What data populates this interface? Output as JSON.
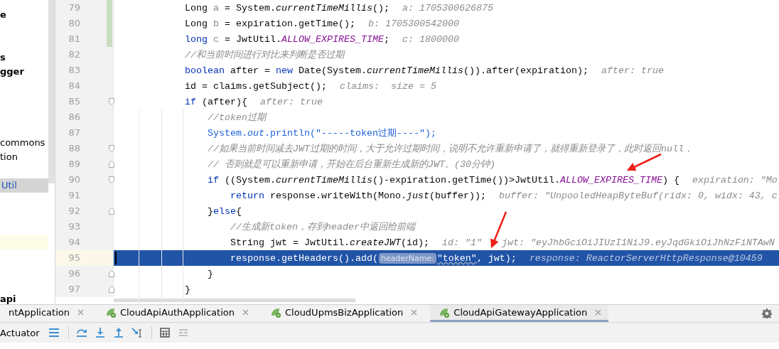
{
  "project_tree": {
    "items": [
      {
        "label": "e",
        "kind": "module",
        "selected": false
      },
      {
        "label": "s",
        "kind": "module",
        "selected": false
      },
      {
        "label": "gger",
        "kind": "module",
        "selected": false
      },
      {
        "label": "commons",
        "kind": "file",
        "selected": false
      },
      {
        "label": "tion",
        "kind": "file",
        "selected": false
      },
      {
        "label": "Util",
        "kind": "file",
        "selected": true
      },
      {
        "label": "api",
        "kind": "module",
        "selected": false
      }
    ]
  },
  "editor": {
    "lines": [
      {
        "number": "79",
        "selected": false,
        "changed": true,
        "fold_start": false,
        "fold_end": false,
        "segments": [
          {
            "kind": "text",
            "text": "Long "
          },
          {
            "kind": "dim",
            "text": "a"
          },
          {
            "kind": "text",
            "text": " = System."
          },
          {
            "kind": "italic",
            "text": "currentTimeMillis"
          },
          {
            "kind": "text",
            "text": "();"
          },
          {
            "kind": "hint",
            "text": "a: 1705300626875"
          }
        ]
      },
      {
        "number": "80",
        "selected": false,
        "changed": true,
        "fold_start": false,
        "fold_end": false,
        "segments": [
          {
            "kind": "text",
            "text": "Long "
          },
          {
            "kind": "dim",
            "text": "b"
          },
          {
            "kind": "text",
            "text": " = expiration.getTime();"
          },
          {
            "kind": "hint",
            "text": "b: 1705300542000"
          }
        ]
      },
      {
        "number": "81",
        "selected": false,
        "changed": true,
        "fold_start": false,
        "fold_end": false,
        "segments": [
          {
            "kind": "keyword",
            "text": "long "
          },
          {
            "kind": "dim",
            "text": "c"
          },
          {
            "kind": "text",
            "text": " = JwtUtil."
          },
          {
            "kind": "constant",
            "text": "ALLOW_EXPIRES_TIME"
          },
          {
            "kind": "text",
            "text": ";"
          },
          {
            "kind": "hint",
            "text": "c: 1800000"
          }
        ]
      },
      {
        "number": "82",
        "selected": false,
        "changed": false,
        "fold_start": false,
        "fold_end": false,
        "segments": [
          {
            "kind": "comment",
            "text": "//和当前时间进行对比来判断是否过期"
          }
        ]
      },
      {
        "number": "83",
        "selected": false,
        "changed": false,
        "fold_start": false,
        "fold_end": false,
        "segments": [
          {
            "kind": "keyword",
            "text": "boolean"
          },
          {
            "kind": "text",
            "text": " after = "
          },
          {
            "kind": "keyword",
            "text": "new"
          },
          {
            "kind": "text",
            "text": " Date(System."
          },
          {
            "kind": "italic",
            "text": "currentTimeMillis"
          },
          {
            "kind": "text",
            "text": "()).after(expiration);"
          },
          {
            "kind": "hint",
            "text": "after: true"
          }
        ]
      },
      {
        "number": "84",
        "selected": false,
        "changed": false,
        "fold_start": false,
        "fold_end": false,
        "segments": [
          {
            "kind": "text",
            "text": "id = claims.getSubject();"
          },
          {
            "kind": "hint",
            "text": "claims:  size = 5"
          }
        ]
      },
      {
        "number": "85",
        "selected": false,
        "changed": false,
        "fold_start": true,
        "fold_end": false,
        "segments": [
          {
            "kind": "keyword",
            "text": "if"
          },
          {
            "kind": "text",
            "text": " (after){"
          },
          {
            "kind": "hint",
            "text": "after: true"
          }
        ],
        "children": [
          {
            "number": "86",
            "selected": false,
            "changed": false,
            "fold_start": false,
            "fold_end": false,
            "segments": [
              {
                "kind": "comment",
                "text": "//token过期"
              }
            ]
          },
          {
            "number": "87",
            "selected": false,
            "changed": false,
            "fold_start": false,
            "fold_end": false,
            "segments": [
              {
                "kind": "call",
                "text": "System."
              },
              {
                "kind": "call-italic",
                "text": "out"
              },
              {
                "kind": "call",
                "text": ".println(\"-----token过期----\");"
              }
            ]
          },
          {
            "number": "88",
            "selected": false,
            "changed": false,
            "fold_start": true,
            "fold_end": false,
            "segments": [
              {
                "kind": "comment",
                "text": "//如果当前时间减去JWT过期的时间，大于允许过期时间，说明不允许重新申请了，就得重新登录了，此时返回null，"
              }
            ]
          },
          {
            "number": "89",
            "selected": false,
            "changed": false,
            "fold_start": false,
            "fold_end": true,
            "segments": [
              {
                "kind": "comment",
                "text": "// 否则就是可以重新申请，开始在后台重新生成新的JWT。(30分钟)"
              }
            ]
          },
          {
            "number": "90",
            "selected": false,
            "changed": false,
            "fold_start": true,
            "fold_end": false,
            "segments": [
              {
                "kind": "keyword",
                "text": "if"
              },
              {
                "kind": "text",
                "text": " ((System."
              },
              {
                "kind": "italic",
                "text": "currentTimeMillis"
              },
              {
                "kind": "text",
                "text": "()-expiration.getTime())>JwtUtil."
              },
              {
                "kind": "constant",
                "text": "ALLOW_EXPIRES_TIME"
              },
              {
                "kind": "text",
                "text": ") {"
              },
              {
                "kind": "hint",
                "text": "expiration: \"Mo"
              }
            ],
            "children": [
              {
                "number": "91",
                "selected": false,
                "changed": false,
                "fold_start": false,
                "fold_end": false,
                "segments": [
                  {
                    "kind": "keyword",
                    "text": "return"
                  },
                  {
                    "kind": "text",
                    "text": " response.writeWith(Mono."
                  },
                  {
                    "kind": "italic",
                    "text": "just"
                  },
                  {
                    "kind": "text",
                    "text": "(buffer));"
                  },
                  {
                    "kind": "hint",
                    "text": "buffer: \"UnpooledHeapByteBuf(ridx: 0, widx: 43, c"
                  }
                ]
              }
            ]
          },
          {
            "number": "92",
            "selected": false,
            "changed": false,
            "fold_start": false,
            "fold_end": true,
            "segments": [
              {
                "kind": "text",
                "text": "}"
              },
              {
                "kind": "keyword",
                "text": "else"
              },
              {
                "kind": "text",
                "text": "{"
              }
            ],
            "children": [
              {
                "number": "93",
                "selected": false,
                "changed": false,
                "fold_start": false,
                "fold_end": false,
                "segments": [
                  {
                    "kind": "comment",
                    "text": "//生成新token，存到header中返回给前端"
                  }
                ]
              },
              {
                "number": "94",
                "selected": false,
                "changed": false,
                "fold_start": false,
                "fold_end": false,
                "segments": [
                  {
                    "kind": "text",
                    "text": "String jwt = JwtUtil."
                  },
                  {
                    "kind": "italic",
                    "text": "createJWT"
                  },
                  {
                    "kind": "text",
                    "text": "(id);"
                  },
                  {
                    "kind": "hint",
                    "text": "id: \"1\""
                  },
                  {
                    "kind": "hint",
                    "text": "jwt: \"eyJhbGciOiJIUzI1NiJ9.eyJqdGkiOiJhNzFiNTAwN"
                  }
                ]
              },
              {
                "number": "95",
                "selected": true,
                "changed": false,
                "fold_start": false,
                "fold_end": false,
                "segments": [
                  {
                    "kind": "text",
                    "text": "response.getHeaders().add("
                  },
                  {
                    "kind": "param",
                    "text": "headerName:"
                  },
                  {
                    "kind": "typo",
                    "text": "\"token\""
                  },
                  {
                    "kind": "text",
                    "text": ", jwt);"
                  },
                  {
                    "kind": "hint",
                    "text": "response: ReactorServerHttpResponse@10459"
                  }
                ]
              }
            ]
          },
          {
            "number": "96",
            "selected": false,
            "changed": false,
            "fold_start": false,
            "fold_end": true,
            "segments": [
              {
                "kind": "text",
                "text": "}"
              }
            ]
          }
        ]
      },
      {
        "number": "97",
        "selected": false,
        "changed": false,
        "fold_start": false,
        "fold_end": true,
        "segments": [
          {
            "kind": "text",
            "text": "}"
          }
        ]
      }
    ]
  },
  "run_tabs": [
    {
      "label": "ntApplication",
      "selected": false,
      "icon": false
    },
    {
      "label": "CloudApiAuthApplication",
      "selected": false,
      "icon": true
    },
    {
      "label": "CloudUpmsBizApplication",
      "selected": false,
      "icon": true
    },
    {
      "label": "CloudApiGatewayApplication",
      "selected": true,
      "icon": true
    }
  ],
  "debug_toolbar": {
    "label": "Actuator"
  }
}
